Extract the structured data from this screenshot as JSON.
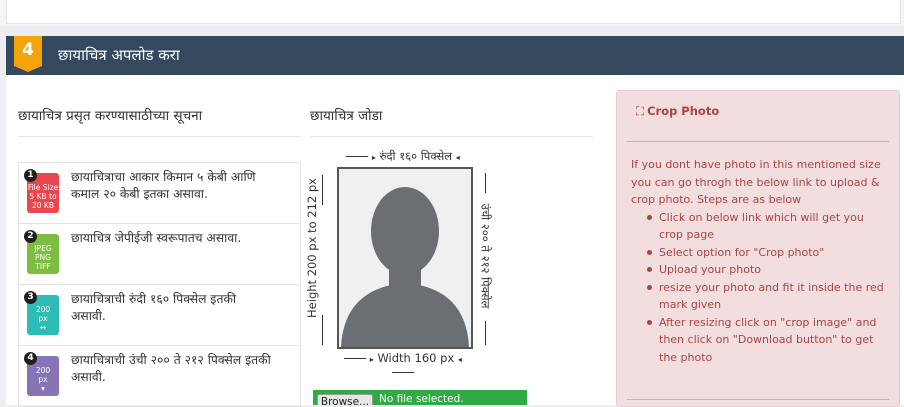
{
  "section": {
    "number": "4",
    "title": "छायाचित्र अपलोड करा"
  },
  "instructions": {
    "heading": "छायाचित्र प्रसृत करण्यासाठीच्या सूचना",
    "items": [
      {
        "badge": "1",
        "icon": [
          "File Size",
          "5 KB to",
          "20 KB"
        ],
        "icon_color": "#e8474d",
        "text": "छायाचित्राचा आकार किमान ५ केबी आणि कमाल २० केबी इतका असावा."
      },
      {
        "badge": "2",
        "icon": [
          "JPEG",
          "PNG",
          "TIFF"
        ],
        "icon_color": "#7dbd42",
        "text": "छायाचित्र जेपीईजी स्वरूपातच असावा."
      },
      {
        "badge": "3",
        "icon": [
          "200",
          "px",
          "↔"
        ],
        "icon_color": "#2dbbb5",
        "text": "छायाचित्राची रुंदी १६० पिक्सेल इतकी असावी."
      },
      {
        "badge": "4",
        "icon": [
          "200",
          "px",
          "▾"
        ],
        "icon_color": "#8674b7",
        "text": "छायाचित्राची उंची २०० ते २१२ पिक्सेल इतकी असावी."
      }
    ]
  },
  "attach": {
    "heading": "छायाचित्र जोडा",
    "width_top": "रुंदी १६० पिक्सेल",
    "height_left": "Height 200 px to 212 px",
    "height_right": "उंची २०० ते २१२ पिक्सेल",
    "width_bottom": "Width 160 px",
    "browse_label": "Browse...",
    "no_file": "No file selected."
  },
  "crop": {
    "title": "Crop Photo",
    "icon": "crop-icon",
    "intro": "If you dont have photo in this mentioned size you can go throgh the below link to upload & crop photo. Steps are as below",
    "steps": [
      "Click on below link which will get you crop page",
      "Select option for \"Crop photo\"",
      "Upload your photo",
      "resize your photo and fit it inside the red mark given",
      "After resizing click on \"crop image\" and then click on \"Download button\" to get the photo"
    ]
  }
}
